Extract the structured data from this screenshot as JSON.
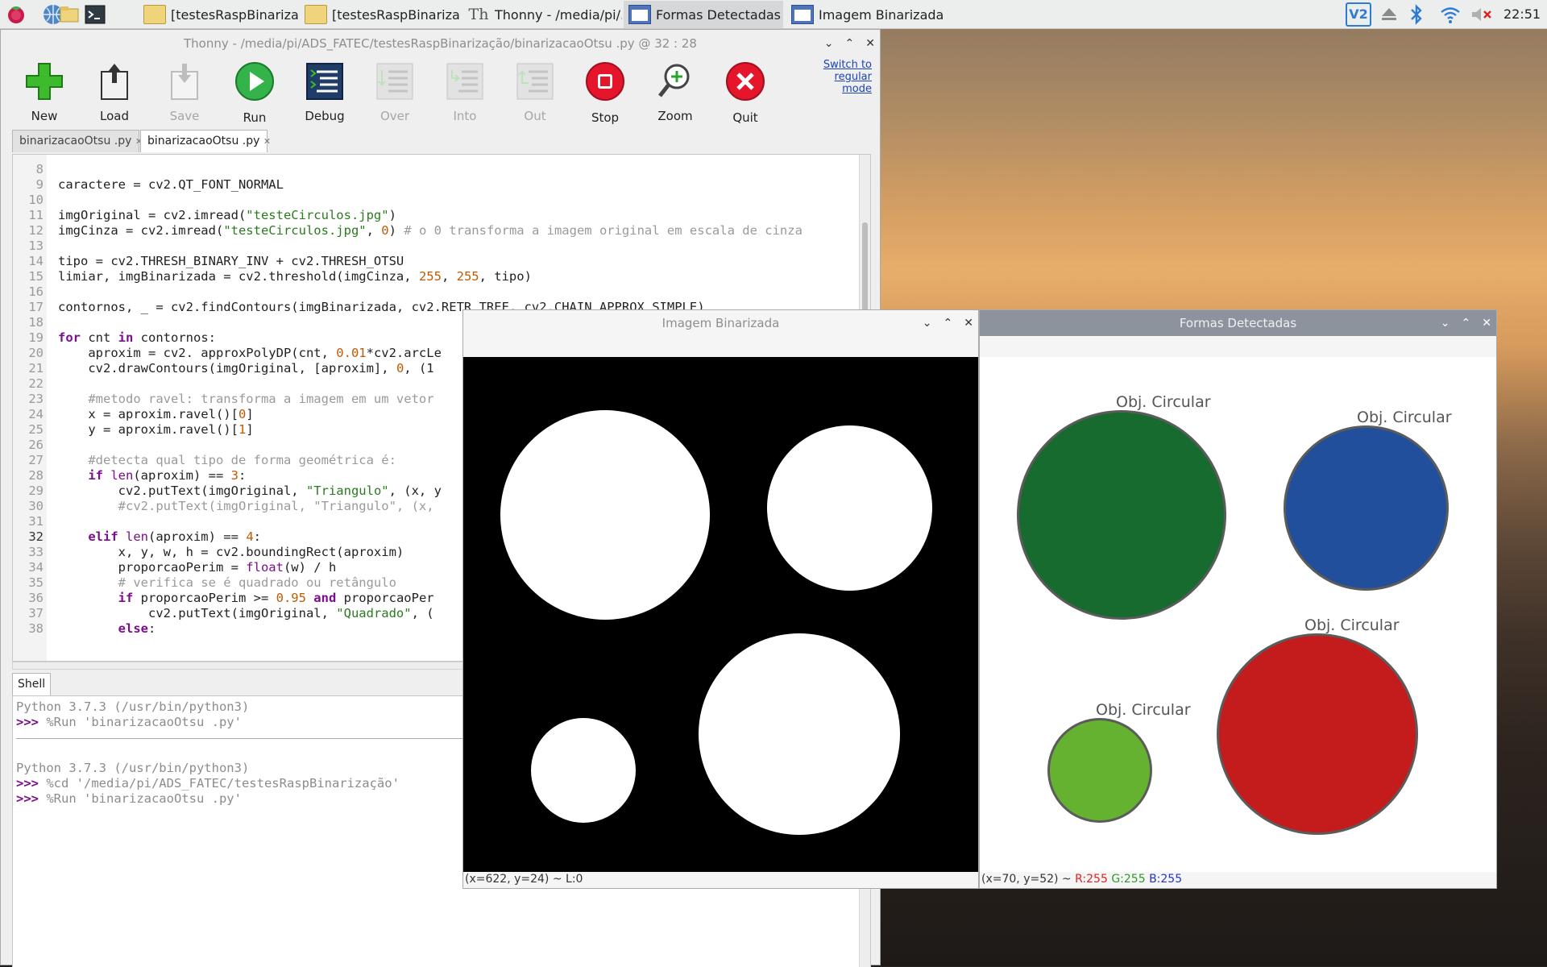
{
  "taskbar": {
    "tasks": [
      "[testesRaspBinarizaç...",
      "[testesRaspBinarizaç...",
      "Thonny  -  /media/pi/...",
      "Formas Detectadas",
      "Imagem Binarizada"
    ],
    "clock": "22:51",
    "tray_vnc": "V2"
  },
  "thonny": {
    "title": "Thonny  -  /media/pi/ADS_FATEC/testesRaspBinarização/binarizacaoOtsu .py  @  32 : 28",
    "toolbar": {
      "new": "New",
      "load": "Load",
      "save": "Save",
      "run": "Run",
      "debug": "Debug",
      "over": "Over",
      "into": "Into",
      "out": "Out",
      "stop": "Stop",
      "zoom": "Zoom",
      "quit": "Quit"
    },
    "switch_mode": "Switch to regular mode",
    "tabs": [
      "binarizacaoOtsu .py",
      "binarizacaoOtsu .py"
    ],
    "tab_close": "✕",
    "line_numbers": [
      "8",
      "9",
      "10",
      "11",
      "12",
      "13",
      "14",
      "15",
      "16",
      "17",
      "18",
      "19",
      "20",
      "21",
      "22",
      "23",
      "24",
      "25",
      "26",
      "27",
      "28",
      "29",
      "30",
      "31",
      "32",
      "33",
      "34",
      "35",
      "36",
      "37",
      "38"
    ],
    "shell_tab": "Shell",
    "shell": {
      "l1": "Python 3.7.3 (/usr/bin/python3)",
      "prompt": ">>>",
      "l2": " %Run 'binarizacaoOtsu .py'",
      "l3": "Python 3.7.3 (/usr/bin/python3)",
      "l4": " %cd '/media/pi/ADS_FATEC/testesRaspBinarização'",
      "l5": " %Run 'binarizacaoOtsu .py'"
    }
  },
  "code": {
    "l9": "caractere = cv2.QT_FONT_NORMAL",
    "l11a": "imgOriginal = cv2.imread(",
    "l11s": "\"testeCirculos.jpg\"",
    "l11b": ")",
    "l12a": "imgCinza = cv2.imread(",
    "l12s": "\"testeCirculos.jpg\"",
    "l12b": ", ",
    "l12n": "0",
    "l12c": ") ",
    "l12cm": "# o 0 transforma a imagem original em escala de cinza",
    "l14": "tipo = cv2.THRESH_BINARY_INV + cv2.THRESH_OTSU",
    "l15a": "limiar, imgBinarizada = cv2.threshold(imgCinza, ",
    "l15n1": "255",
    "l15b": ", ",
    "l15n2": "255",
    "l15c": ", tipo)",
    "l17": "contornos, _ = cv2.findContours(imgBinarizada, cv2.RETR_TREE, cv2.CHAIN_APPROX_SIMPLE)",
    "l19k1": "for",
    "l19a": " cnt ",
    "l19k2": "in",
    "l19b": " contornos:",
    "l20a": "    aproxim = cv2. approxPolyDP(cnt, ",
    "l20n": "0.01",
    "l20b": "*cv2.arcLe",
    "l21a": "    cv2.drawContours(imgOriginal, [aproxim], ",
    "l21n": "0",
    "l21b": ", (1",
    "l23": "    #metodo ravel: transforma a imagem em um vetor",
    "l24a": "    x = aproxim.ravel()[",
    "l24n": "0",
    "l24b": "]",
    "l25a": "    y = aproxim.ravel()[",
    "l25n": "1",
    "l25b": "]",
    "l27": "    #detecta qual tipo de forma geométrica é:",
    "l28k": "    if",
    "l28bi": " len",
    "l28a": "(aproxim) == ",
    "l28n": "3",
    "l28b": ":",
    "l29a": "        cv2.putText(imgOriginal, ",
    "l29s": "\"Triangulo\"",
    "l29b": ", (x, y",
    "l30": "        #cv2.putText(imgOriginal, \"Triangulo\", (x,",
    "l32k": "    elif",
    "l32bi": " len",
    "l32a": "(aproxim) == ",
    "l32n": "4",
    "l32b": ":",
    "l33": "        x, y, w, h = cv2.boundingRect(aproxim)",
    "l34a": "        proporcaoPerim = ",
    "l34bi": "float",
    "l34b": "(w) / h",
    "l35": "        # verifica se é quadrado ou retângulo",
    "l36k": "        if",
    "l36a": " proporcaoPerim >= ",
    "l36n": "0.95",
    "l36k2": " and",
    "l36b": " proporcaoPer",
    "l37a": "            cv2.putText(imgOriginal, ",
    "l37s": "\"Quadrado\"",
    "l37b": ", (",
    "l38k": "        else",
    "l38b": ":"
  },
  "binarized_window": {
    "title": "Imagem Binarizada",
    "status": "(x=622, y=24) ~ L:0"
  },
  "shapes_window": {
    "title": "Formas Detectadas",
    "labels": [
      "Obj. Circular",
      "Obj. Circular",
      "Obj. Circular",
      "Obj. Circular"
    ],
    "status_prefix": "(x=70, y=52) ~ ",
    "status_r": "R:255",
    "status_g": "G:255",
    "status_b": "B:255"
  },
  "colors": {
    "green_circle": "#176b2e",
    "blue_circle": "#214f9c",
    "red_circle": "#c41c1c",
    "lightgreen_circle": "#64b22f",
    "accent_link": "#1b44b4"
  }
}
